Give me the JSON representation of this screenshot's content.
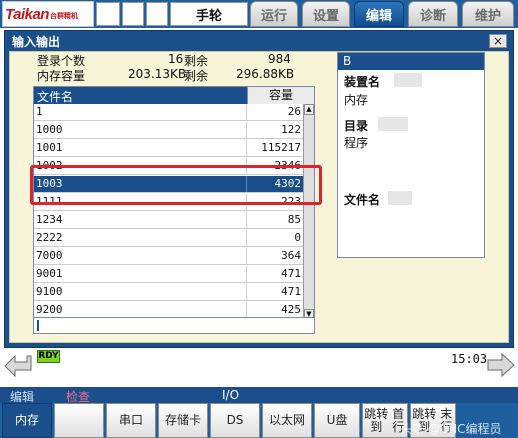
{
  "logo": {
    "brand": "Taikan",
    "sub": "台群精机"
  },
  "header": {
    "mode": "手轮",
    "tabs": [
      {
        "label": "运行",
        "active": false
      },
      {
        "label": "设置",
        "active": false
      },
      {
        "label": "编辑",
        "active": true
      },
      {
        "label": "诊断",
        "active": false
      },
      {
        "label": "维护",
        "active": false
      }
    ]
  },
  "window": {
    "title": "输入输出",
    "close_symbol": "×"
  },
  "stats": {
    "registered_label": "登录个数",
    "registered_value": "16",
    "remain_label_1": "剩余",
    "remain_value_1": "984",
    "memory_label": "内存容量",
    "memory_value": "203.13KB",
    "remain_label_2": "剩余",
    "remain_value_2": "296.88KB"
  },
  "file_table": {
    "col_name": "文件名",
    "col_size": "容量",
    "rows": [
      {
        "name": "1",
        "size": "26"
      },
      {
        "name": "1000",
        "size": "122"
      },
      {
        "name": "1001",
        "size": "115217"
      },
      {
        "name": "1002",
        "size": "2346"
      },
      {
        "name": "1003",
        "size": "4302"
      },
      {
        "name": "1111",
        "size": "223"
      },
      {
        "name": "1234",
        "size": "85"
      },
      {
        "name": "2222",
        "size": "0"
      },
      {
        "name": "7000",
        "size": "364"
      },
      {
        "name": "9001",
        "size": "471"
      },
      {
        "name": "9100",
        "size": "471"
      },
      {
        "name": "9200",
        "size": "425"
      }
    ],
    "selected_index": 4
  },
  "info": {
    "title": "B",
    "device_label": "装置名",
    "device_value": "内存",
    "dir_label": "目录",
    "dir_value": "程序",
    "file_label": "文件名"
  },
  "status": {
    "ready": "RDY",
    "time": "15:03"
  },
  "bottom": {
    "left_labels": [
      "编辑",
      "检查"
    ],
    "center_label": "I/O",
    "softkeys": [
      {
        "label": "内存",
        "active": true
      },
      {
        "label": "",
        "active": false
      },
      {
        "label": "串口",
        "active": false
      },
      {
        "label": "存储卡",
        "active": false
      },
      {
        "label": "DS",
        "active": false
      },
      {
        "label": "以太网",
        "active": false
      },
      {
        "label": "U盘",
        "active": false
      },
      {
        "label": "跳转到首行",
        "active": false
      },
      {
        "label": "跳转到末行",
        "active": false
      }
    ],
    "watermark": "头条 @CNC编程员"
  },
  "colors": {
    "theme_blue": "#1f5fa0",
    "highlight_red": "#d9262a",
    "ready_green": "#7ed321",
    "panel_bg": "#f7f4d7"
  }
}
